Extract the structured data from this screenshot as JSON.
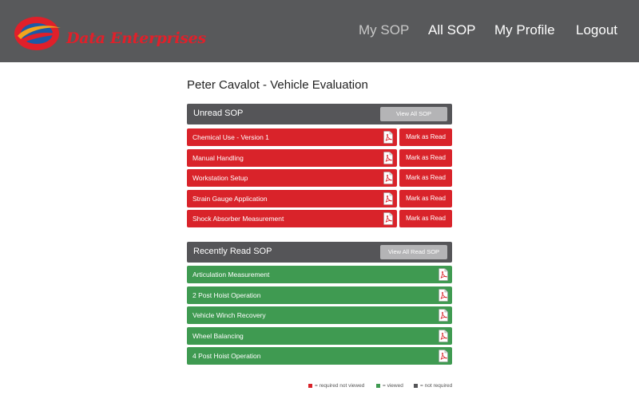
{
  "header": {
    "brand": "Data Enterprises",
    "nav": [
      "My SOP",
      "All SOP",
      "My Profile",
      "Logout"
    ],
    "active_nav": "My SOP"
  },
  "page": {
    "title": "Peter Cavalot - Vehicle Evaluation"
  },
  "unread": {
    "heading": "Unread SOP",
    "view_all_label": "View All SOP",
    "mark_label": "Mark as Read",
    "items": [
      "Chemical Use - Version 1",
      "Manual Handling",
      "Workstation Setup",
      "Strain Gauge Application",
      "Shock Absorber Measurement"
    ]
  },
  "recent": {
    "heading": "Recently Read SOP",
    "view_all_label": "View All Read SOP",
    "items": [
      "Articulation Measurement",
      "2 Post Hoist Operation",
      "Vehicle Winch Recovery",
      "Wheel Balancing",
      "4 Post Hoist Operation"
    ]
  },
  "legend": {
    "required_not_viewed": "= required not viewed",
    "viewed": "= viewed",
    "not_required": "= not required"
  },
  "colors": {
    "header": "#58595b",
    "required_not_viewed": "#d9232a",
    "viewed": "#3f9a51",
    "not_required": "#555558",
    "brand_red": "#e0202a",
    "brand_blue": "#1b5aa6",
    "brand_orange": "#f2a51d"
  },
  "icons": {
    "logo": "swoosh-logo",
    "document": "pdf-icon"
  }
}
